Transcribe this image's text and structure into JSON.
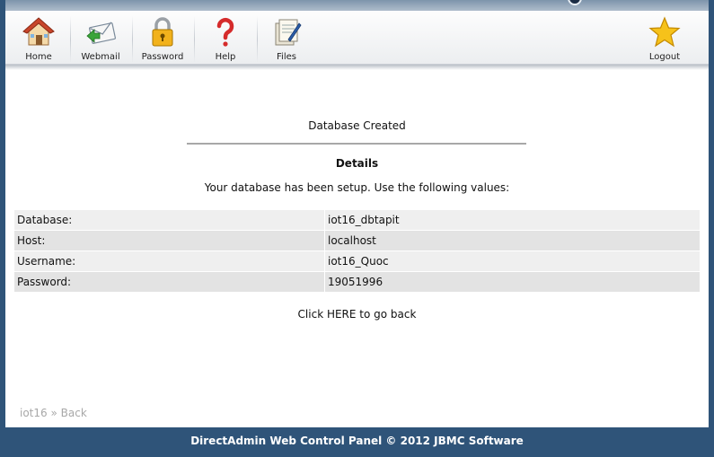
{
  "toolbar": {
    "items": [
      {
        "label": "Home",
        "icon": "home-icon"
      },
      {
        "label": "Webmail",
        "icon": "webmail-icon"
      },
      {
        "label": "Password",
        "icon": "lock-icon"
      },
      {
        "label": "Help",
        "icon": "question-icon"
      },
      {
        "label": "Files",
        "icon": "files-icon"
      }
    ],
    "logout": {
      "label": "Logout",
      "icon": "star-icon"
    }
  },
  "main": {
    "title": "Database Created",
    "details_heading": "Details",
    "message": "Your database has been setup. Use the following values:",
    "rows": [
      {
        "key": "Database:",
        "value": "iot16_dbtapit"
      },
      {
        "key": "Host:",
        "value": "localhost"
      },
      {
        "key": "Username:",
        "value": "iot16_Quoc"
      },
      {
        "key": "Password:",
        "value": "19051996"
      }
    ],
    "back_link": "Click HERE to go back"
  },
  "breadcrumb": {
    "user": "iot16",
    "separator": "»",
    "back": "Back"
  },
  "footer": {
    "text": "DirectAdmin Web Control Panel © 2012 JBMC Software"
  },
  "colors": {
    "frame_blue": "#2f5479",
    "row_light": "#efefef",
    "row_dark": "#e3e3e3"
  }
}
